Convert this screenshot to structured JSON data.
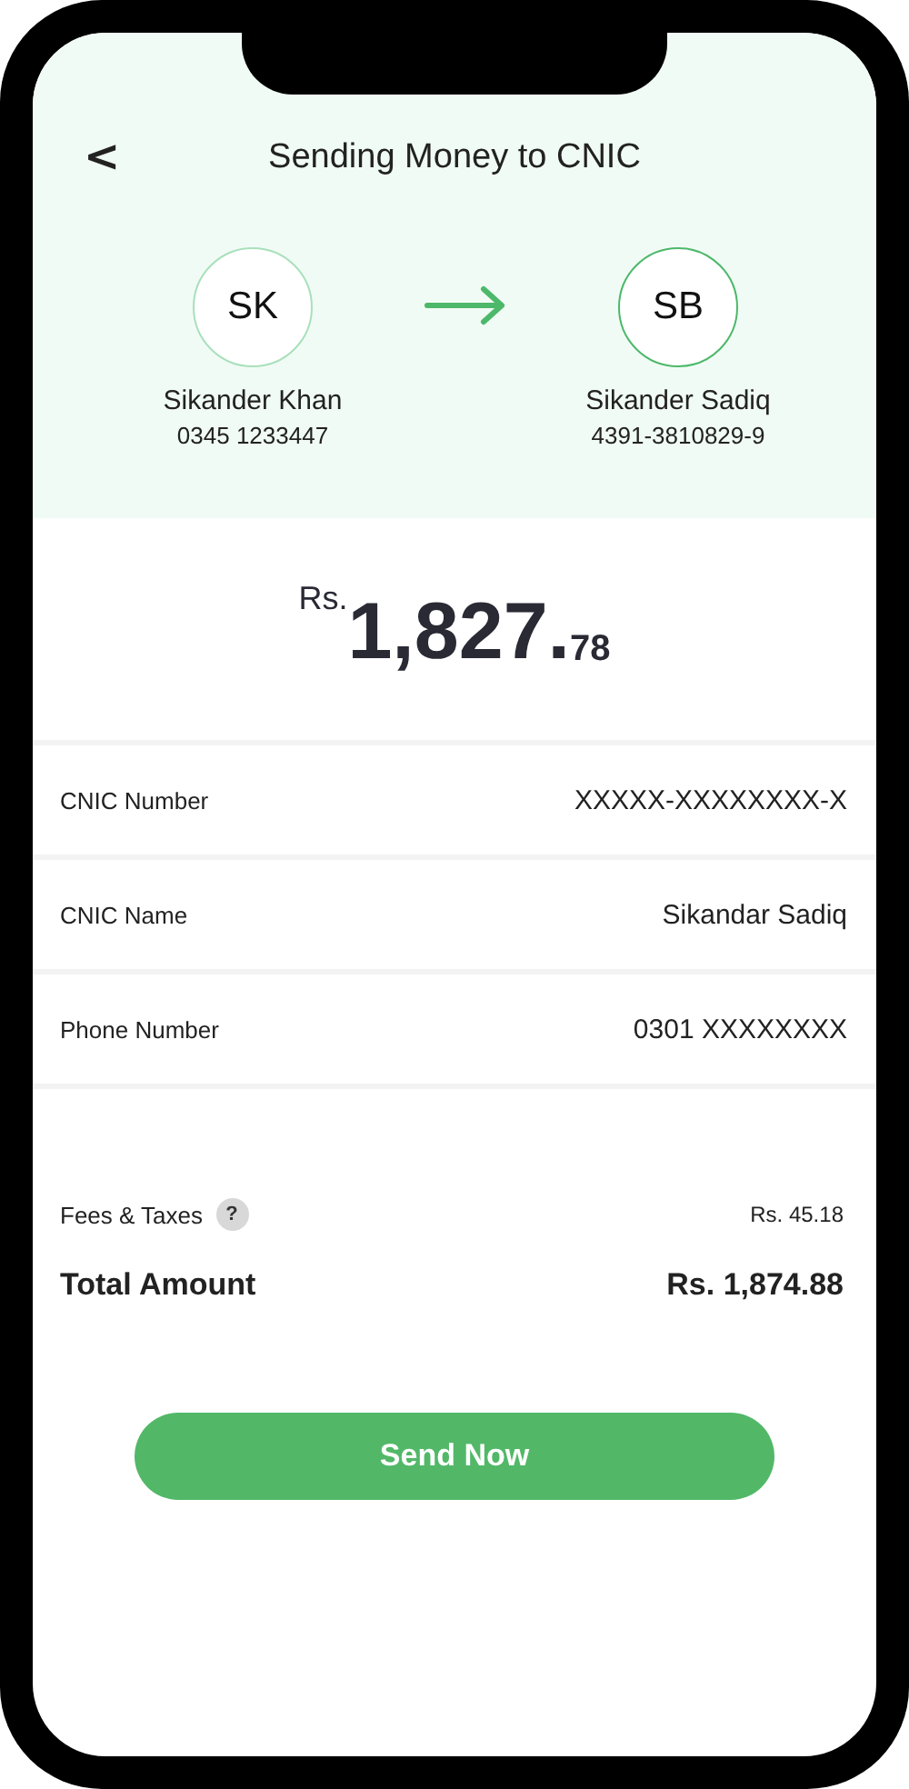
{
  "header": {
    "back": "<",
    "title": "Sending Money to CNIC"
  },
  "sender": {
    "initials": "SK",
    "name": "Sikander Khan",
    "detail": "0345 1233447",
    "color": "#a8e0bb"
  },
  "receiver": {
    "initials": "SB",
    "name": "Sikander Sadiq",
    "detail": "4391-3810829-9",
    "color": "#4cb86a"
  },
  "amount": {
    "currency": "Rs.",
    "whole": "1,827.",
    "decimals": "78"
  },
  "details": [
    {
      "label": "CNIC Number",
      "value": "XXXXX-XXXXXXXX-X"
    },
    {
      "label": "CNIC Name",
      "value": "Sikandar Sadiq"
    },
    {
      "label": "Phone Number",
      "value": "0301 XXXXXXXX"
    }
  ],
  "fees": {
    "label": "Fees & Taxes",
    "help": "?",
    "value": "Rs. 45.18"
  },
  "total": {
    "label": "Total Amount",
    "value": "Rs. 1,874.88"
  },
  "button": "Send Now"
}
